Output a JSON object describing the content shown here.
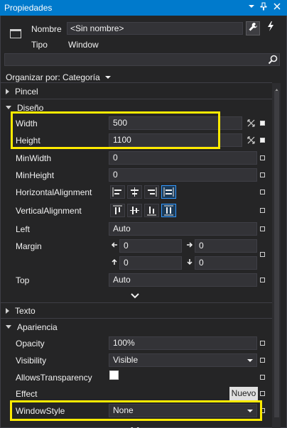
{
  "window": {
    "title": "Propiedades",
    "icons": [
      "dropdown-icon",
      "pin-icon",
      "close-icon"
    ]
  },
  "header": {
    "name_label": "Nombre",
    "name_value": "<Sin nombre>",
    "type_label": "Tipo",
    "type_value": "Window"
  },
  "search": {
    "placeholder": ""
  },
  "arrange": {
    "label": "Organizar por: Categoría"
  },
  "categories": {
    "pincel": "Pincel",
    "diseno": "Diseño",
    "texto": "Texto",
    "apariencia": "Apariencia"
  },
  "layout_props": {
    "width_label": "Width",
    "width_value": "500",
    "height_label": "Height",
    "height_value": "1100",
    "minwidth_label": "MinWidth",
    "minwidth_value": "0",
    "minheight_label": "MinHeight",
    "minheight_value": "0",
    "halign_label": "HorizontalAlignment",
    "valign_label": "VerticalAlignment",
    "left_label": "Left",
    "left_value": "Auto",
    "margin_label": "Margin",
    "margin_left": "0",
    "margin_right": "0",
    "margin_top": "0",
    "margin_bottom": "0",
    "top_label": "Top",
    "top_value": "Auto"
  },
  "appearance_props": {
    "opacity_label": "Opacity",
    "opacity_value": "100%",
    "visibility_label": "Visibility",
    "visibility_value": "Visible",
    "allowstransparency_label": "AllowsTransparency",
    "effect_label": "Effect",
    "effect_button": "Nuevo",
    "windowstyle_label": "WindowStyle",
    "windowstyle_value": "None"
  },
  "colors": {
    "titlebar": "#007acc",
    "panel_bg": "#252526",
    "field_bg": "#333337",
    "highlight": "#ffeb00",
    "active_align": "#3399ff"
  }
}
